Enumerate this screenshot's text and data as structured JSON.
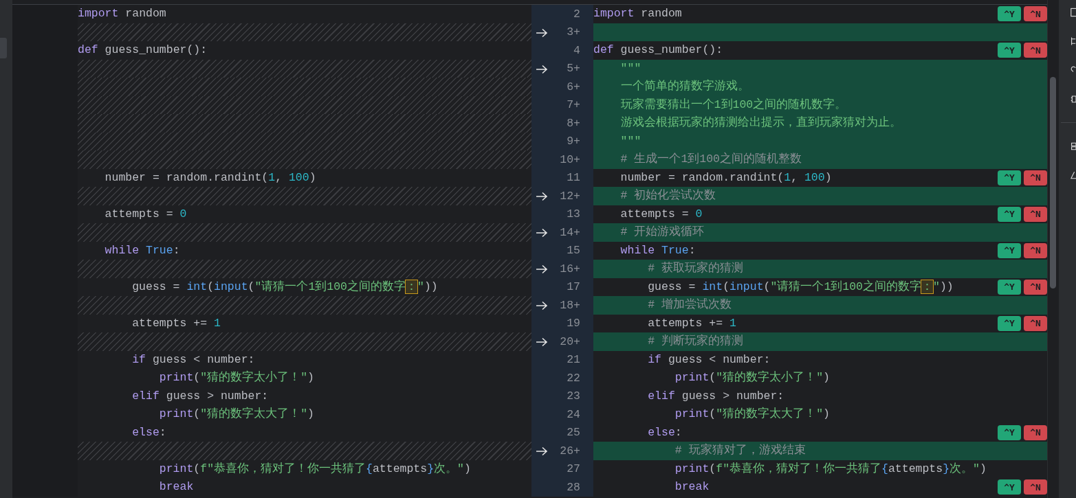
{
  "rows": [
    {
      "num": "2",
      "added": false,
      "arrow": false,
      "left": [
        {
          "text": "import",
          "kind": "kw"
        },
        {
          "text": " random",
          "kind": "pl"
        }
      ],
      "right": [
        {
          "text": "import",
          "kind": "kw"
        },
        {
          "text": " random",
          "kind": "pl"
        }
      ],
      "actions": [
        {
          "label": "^Y",
          "kind": "accept"
        },
        {
          "label": "^N",
          "kind": "reject"
        }
      ]
    },
    {
      "num": "3+",
      "added": true,
      "arrow": true
    },
    {
      "num": "4",
      "added": false,
      "arrow": false,
      "left": [
        {
          "text": "def",
          "kind": "kw"
        },
        {
          "text": " guess_number():",
          "kind": "pl"
        }
      ],
      "right": [
        {
          "text": "def",
          "kind": "kw"
        },
        {
          "text": " guess_number():",
          "kind": "pl"
        }
      ],
      "actions": [
        {
          "label": "^Y",
          "kind": "accept"
        },
        {
          "label": "^N",
          "kind": "reject"
        }
      ]
    },
    {
      "num": "5+",
      "added": true,
      "arrow": true,
      "right": [
        {
          "text": "    \"\"\"",
          "kind": "str"
        }
      ]
    },
    {
      "num": "6+",
      "added": true,
      "arrow": false,
      "right": [
        {
          "text": "    一个简单的猜数字游戏。",
          "kind": "str"
        }
      ]
    },
    {
      "num": "7+",
      "added": true,
      "arrow": false,
      "right": [
        {
          "text": "    玩家需要猜出一个1到100之间的随机数字。",
          "kind": "str"
        }
      ]
    },
    {
      "num": "8+",
      "added": true,
      "arrow": false,
      "right": [
        {
          "text": "    游戏会根据玩家的猜测给出提示，直到玩家猜对为止。",
          "kind": "str"
        }
      ]
    },
    {
      "num": "9+",
      "added": true,
      "arrow": false,
      "right": [
        {
          "text": "    \"\"\"",
          "kind": "str"
        }
      ]
    },
    {
      "num": "10+",
      "added": true,
      "arrow": false,
      "right": [
        {
          "text": "    # 生成一个1到100之间的随机整数",
          "kind": "cm"
        }
      ]
    },
    {
      "num": "11",
      "added": false,
      "arrow": false,
      "left": [
        {
          "text": "    number = random.randint(",
          "kind": "pl"
        },
        {
          "text": "1",
          "kind": "num"
        },
        {
          "text": ", ",
          "kind": "pl"
        },
        {
          "text": "100",
          "kind": "num"
        },
        {
          "text": ")",
          "kind": "pl"
        }
      ],
      "right": [
        {
          "text": "    number = random.randint(",
          "kind": "pl"
        },
        {
          "text": "1",
          "kind": "num"
        },
        {
          "text": ", ",
          "kind": "pl"
        },
        {
          "text": "100",
          "kind": "num"
        },
        {
          "text": ")",
          "kind": "pl"
        }
      ],
      "actions": [
        {
          "label": "^Y",
          "kind": "accept"
        },
        {
          "label": "^N",
          "kind": "reject"
        }
      ]
    },
    {
      "num": "12+",
      "added": true,
      "arrow": true,
      "right": [
        {
          "text": "    # 初始化尝试次数",
          "kind": "cm"
        }
      ]
    },
    {
      "num": "13",
      "added": false,
      "arrow": false,
      "left": [
        {
          "text": "    attempts = ",
          "kind": "pl"
        },
        {
          "text": "0",
          "kind": "num"
        }
      ],
      "right": [
        {
          "text": "    attempts = ",
          "kind": "pl"
        },
        {
          "text": "0",
          "kind": "num"
        }
      ],
      "actions": [
        {
          "label": "^Y",
          "kind": "accept"
        },
        {
          "label": "^N",
          "kind": "reject"
        }
      ]
    },
    {
      "num": "14+",
      "added": true,
      "arrow": true,
      "right": [
        {
          "text": "    # 开始游戏循环",
          "kind": "cm"
        }
      ]
    },
    {
      "num": "15",
      "added": false,
      "arrow": false,
      "left": [
        {
          "text": "    while",
          "kind": "kw"
        },
        {
          "text": " True",
          "kind": "fn"
        },
        {
          "text": ":",
          "kind": "pl"
        }
      ],
      "right": [
        {
          "text": "    while",
          "kind": "kw"
        },
        {
          "text": " True",
          "kind": "fn"
        },
        {
          "text": ":",
          "kind": "pl"
        }
      ],
      "actions": [
        {
          "label": "^Y",
          "kind": "accept"
        },
        {
          "label": "^N",
          "kind": "reject"
        }
      ]
    },
    {
      "num": "16+",
      "added": true,
      "arrow": true,
      "right": [
        {
          "text": "        # 获取玩家的猜测",
          "kind": "cm"
        }
      ]
    },
    {
      "num": "17",
      "added": false,
      "arrow": false,
      "left": [
        {
          "text": "        guess = ",
          "kind": "pl"
        },
        {
          "text": "int",
          "kind": "fn"
        },
        {
          "text": "(",
          "kind": "pl"
        },
        {
          "text": "input",
          "kind": "fn"
        },
        {
          "text": "(",
          "kind": "pl"
        },
        {
          "text": "\"请猜一个1到100之间的数字",
          "kind": "str"
        },
        {
          "text": "：",
          "kind": "warn"
        },
        {
          "text": "\"",
          "kind": "str"
        },
        {
          "text": "))",
          "kind": "pl"
        }
      ],
      "right": [
        {
          "text": "        guess = ",
          "kind": "pl"
        },
        {
          "text": "int",
          "kind": "fn"
        },
        {
          "text": "(",
          "kind": "pl"
        },
        {
          "text": "input",
          "kind": "fn"
        },
        {
          "text": "(",
          "kind": "pl"
        },
        {
          "text": "\"请猜一个1到100之间的数字",
          "kind": "str"
        },
        {
          "text": "：",
          "kind": "warn"
        },
        {
          "text": "\"",
          "kind": "str"
        },
        {
          "text": "))",
          "kind": "pl"
        }
      ],
      "actions": [
        {
          "label": "^Y",
          "kind": "accept"
        },
        {
          "label": "^N",
          "kind": "reject"
        }
      ]
    },
    {
      "num": "18+",
      "added": true,
      "arrow": true,
      "right": [
        {
          "text": "        # 增加尝试次数",
          "kind": "cm"
        }
      ]
    },
    {
      "num": "19",
      "added": false,
      "arrow": false,
      "left": [
        {
          "text": "        attempts += ",
          "kind": "pl"
        },
        {
          "text": "1",
          "kind": "num"
        }
      ],
      "right": [
        {
          "text": "        attempts += ",
          "kind": "pl"
        },
        {
          "text": "1",
          "kind": "num"
        }
      ],
      "actions": [
        {
          "label": "^Y",
          "kind": "accept"
        },
        {
          "label": "^N",
          "kind": "reject"
        }
      ]
    },
    {
      "num": "20+",
      "added": true,
      "arrow": true,
      "right": [
        {
          "text": "        # 判断玩家的猜测",
          "kind": "cm"
        }
      ]
    },
    {
      "num": "21",
      "added": false,
      "arrow": false,
      "left": [
        {
          "text": "        if",
          "kind": "kw"
        },
        {
          "text": " guess < number:",
          "kind": "pl"
        }
      ],
      "right": [
        {
          "text": "        if",
          "kind": "kw"
        },
        {
          "text": " guess < number:",
          "kind": "pl"
        }
      ]
    },
    {
      "num": "22",
      "added": false,
      "arrow": false,
      "left": [
        {
          "text": "            print",
          "kind": "kw"
        },
        {
          "text": "(",
          "kind": "pl"
        },
        {
          "text": "\"猜的数字太小了！\"",
          "kind": "str"
        },
        {
          "text": ")",
          "kind": "pl"
        }
      ],
      "right": [
        {
          "text": "            print",
          "kind": "kw"
        },
        {
          "text": "(",
          "kind": "pl"
        },
        {
          "text": "\"猜的数字太小了！\"",
          "kind": "str"
        },
        {
          "text": ")",
          "kind": "pl"
        }
      ]
    },
    {
      "num": "23",
      "added": false,
      "arrow": false,
      "left": [
        {
          "text": "        elif",
          "kind": "kw"
        },
        {
          "text": " guess > number:",
          "kind": "pl"
        }
      ],
      "right": [
        {
          "text": "        elif",
          "kind": "kw"
        },
        {
          "text": " guess > number:",
          "kind": "pl"
        }
      ]
    },
    {
      "num": "24",
      "added": false,
      "arrow": false,
      "left": [
        {
          "text": "            print",
          "kind": "kw"
        },
        {
          "text": "(",
          "kind": "pl"
        },
        {
          "text": "\"猜的数字太大了！\"",
          "kind": "str"
        },
        {
          "text": ")",
          "kind": "pl"
        }
      ],
      "right": [
        {
          "text": "            print",
          "kind": "kw"
        },
        {
          "text": "(",
          "kind": "pl"
        },
        {
          "text": "\"猜的数字太大了！\"",
          "kind": "str"
        },
        {
          "text": ")",
          "kind": "pl"
        }
      ]
    },
    {
      "num": "25",
      "added": false,
      "arrow": false,
      "left": [
        {
          "text": "        else",
          "kind": "kw"
        },
        {
          "text": ":",
          "kind": "pl"
        }
      ],
      "right": [
        {
          "text": "        else",
          "kind": "kw"
        },
        {
          "text": ":",
          "kind": "pl"
        }
      ],
      "actions": [
        {
          "label": "^Y",
          "kind": "accept"
        },
        {
          "label": "^N",
          "kind": "reject"
        }
      ]
    },
    {
      "num": "26+",
      "added": true,
      "arrow": true,
      "right": [
        {
          "text": "            # 玩家猜对了，游戏结束",
          "kind": "cm"
        }
      ]
    },
    {
      "num": "27",
      "added": false,
      "arrow": false,
      "left": [
        {
          "text": "            print",
          "kind": "kw"
        },
        {
          "text": "(",
          "kind": "pl"
        },
        {
          "text": "f\"恭喜你，猜对了！你一共猜了",
          "kind": "str"
        },
        {
          "text": "{",
          "kind": "fn"
        },
        {
          "text": "attempts",
          "kind": "pl"
        },
        {
          "text": "}",
          "kind": "fn"
        },
        {
          "text": "次。\"",
          "kind": "str"
        },
        {
          "text": ")",
          "kind": "pl"
        }
      ],
      "right": [
        {
          "text": "            print",
          "kind": "kw"
        },
        {
          "text": "(",
          "kind": "pl"
        },
        {
          "text": "f\"恭喜你，猜对了！你一共猜了",
          "kind": "str"
        },
        {
          "text": "{",
          "kind": "fn"
        },
        {
          "text": "attempts",
          "kind": "pl"
        },
        {
          "text": "}",
          "kind": "fn"
        },
        {
          "text": "次。\"",
          "kind": "str"
        },
        {
          "text": ")",
          "kind": "pl"
        }
      ]
    },
    {
      "num": "28",
      "added": false,
      "arrow": false,
      "left": [
        {
          "text": "            break",
          "kind": "kw"
        }
      ],
      "right": [
        {
          "text": "            break",
          "kind": "kw"
        }
      ],
      "actions": [
        {
          "label": "^Y",
          "kind": "accept"
        },
        {
          "label": "^N",
          "kind": "reject"
        }
      ]
    }
  ]
}
